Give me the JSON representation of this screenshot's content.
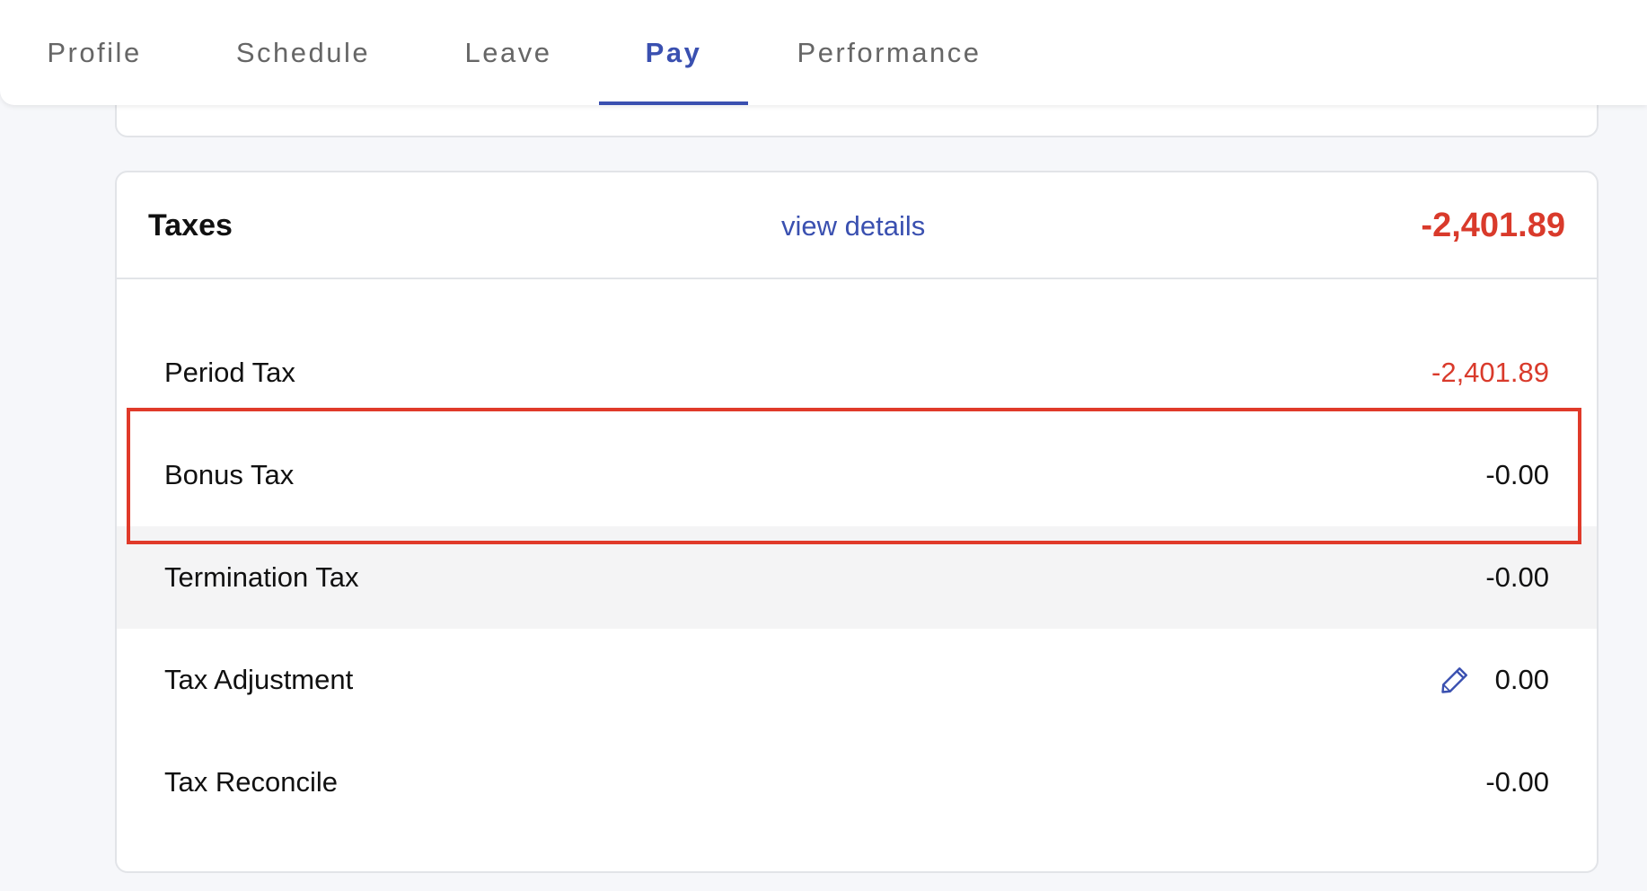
{
  "tabs": [
    {
      "label": "Profile",
      "active": false
    },
    {
      "label": "Schedule",
      "active": false
    },
    {
      "label": "Leave",
      "active": false
    },
    {
      "label": "Pay",
      "active": true
    },
    {
      "label": "Performance",
      "active": false
    }
  ],
  "taxes": {
    "title": "Taxes",
    "view_details_label": "view details",
    "total": "-2,401.89",
    "rows": [
      {
        "label": "Period Tax",
        "value": "-2,401.89",
        "negative_color": true
      },
      {
        "label": "Bonus Tax",
        "value": "-0.00"
      },
      {
        "label": "Termination Tax",
        "value": "-0.00"
      },
      {
        "label": "Tax Adjustment",
        "value": "0.00",
        "editable": true
      },
      {
        "label": "Tax Reconcile",
        "value": "-0.00"
      }
    ]
  },
  "colors": {
    "accent": "#3a50b0",
    "negative": "#d93a2b",
    "highlight": "#e03a2a"
  },
  "icons": {
    "tax_adjustment_edit": "pencil-icon"
  }
}
